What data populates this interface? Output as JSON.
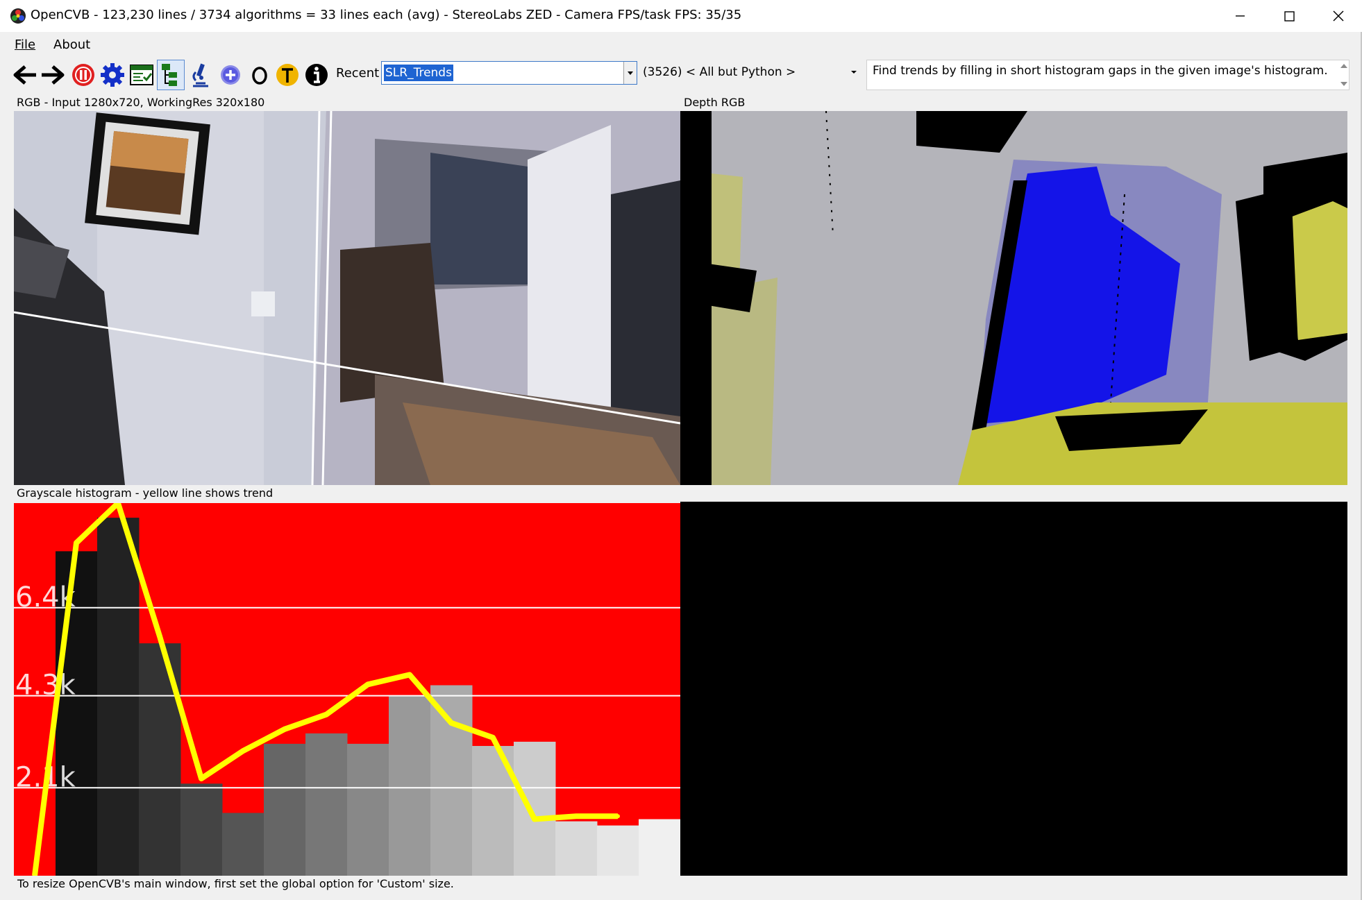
{
  "window": {
    "title": "OpenCVB - 123,230 lines / 3734 algorithms = 33 lines each (avg) - StereoLabs ZED - Camera FPS/task FPS: 35/35"
  },
  "menu": {
    "file": "File",
    "about": "About"
  },
  "toolbar": {
    "icons": [
      "back-arrow-icon",
      "forward-arrow-icon",
      "pause-icon",
      "gear-icon",
      "test-all-icon",
      "treeview-icon",
      "microscope-icon",
      "add-icon",
      "o-icon",
      "translate-icon",
      "info-icon"
    ],
    "recent_label": "Recent",
    "algorithm_selected": "SLR_Trends",
    "group_selected": "(3526) < All but Python >",
    "description": "Find trends by filling in short histogram gaps in the given image's histogram."
  },
  "panels": {
    "rgb_label": "RGB - Input 1280x720, WorkingRes 320x180",
    "depth_label": "Depth RGB",
    "hist_label": "Grayscale histogram - yellow line shows trend"
  },
  "status": "To resize OpenCVB's main window, first set the global option for 'Custom' size.",
  "colors": {
    "hist_background": "#ff0000",
    "trend_line": "#ffff00",
    "grid_line": "#ffffff",
    "depth_blue": "#0000ff",
    "depth_yellow": "#d2d23c"
  },
  "chart_data": {
    "type": "bar",
    "title": "",
    "xlabel": "",
    "ylabel": "",
    "ylim": [
      0,
      8900
    ],
    "y_ticks": [
      {
        "value": 2100,
        "label": "2.1k"
      },
      {
        "value": 4300,
        "label": "4.3k"
      },
      {
        "value": 6400,
        "label": "6.4k"
      }
    ],
    "bins": 16,
    "bar_values": [
      0,
      7750,
      8550,
      5550,
      2200,
      1500,
      3150,
      3400,
      3150,
      4300,
      4550,
      3100,
      3200,
      1300,
      1200,
      1350
    ],
    "bar_grays": [
      "#000000",
      "#111111",
      "#222222",
      "#333333",
      "#444444",
      "#555555",
      "#666666",
      "#777777",
      "#888888",
      "#999999",
      "#aaaaaa",
      "#bbbbbb",
      "#cccccc",
      "#d9d9d9",
      "#e6e6e6",
      "#f0f0f0"
    ],
    "series": [
      {
        "values": [
          0,
          7950,
          8900,
          5720,
          2320,
          2980,
          3500,
          3850,
          4570,
          4800,
          3650,
          3300,
          1350,
          1420,
          1420
        ]
      }
    ]
  }
}
